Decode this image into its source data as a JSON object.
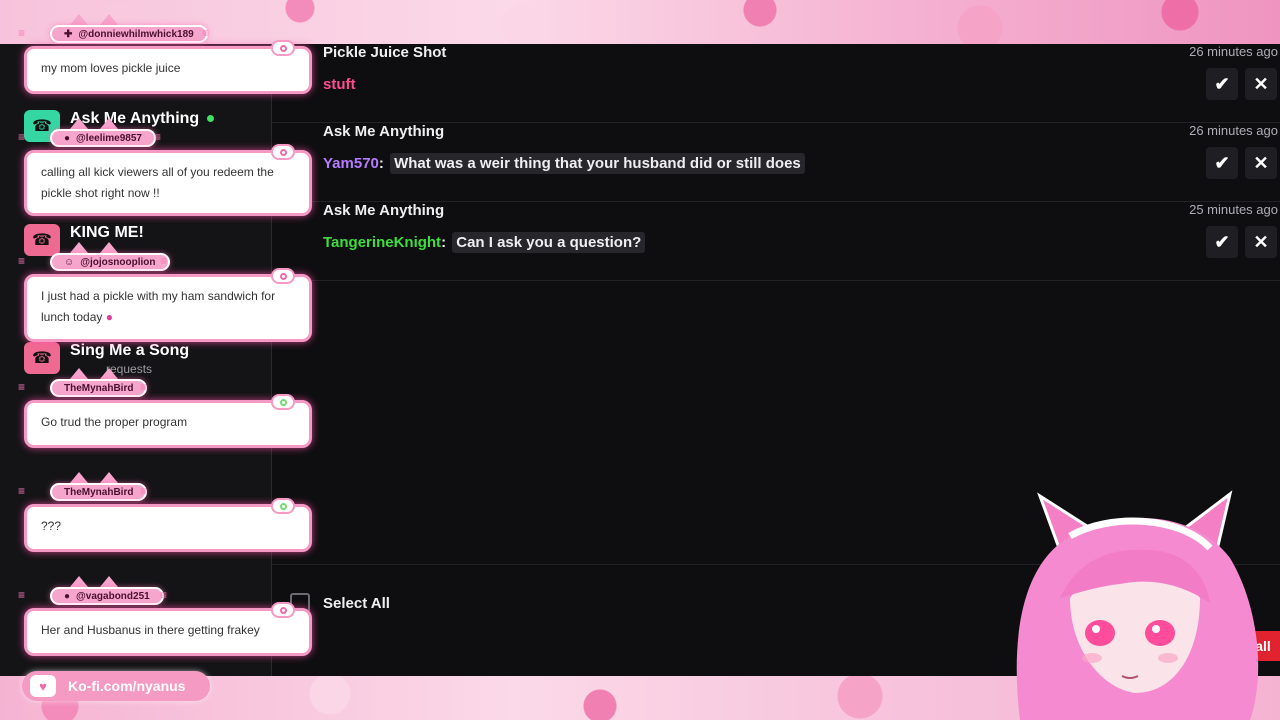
{
  "sidebar": {
    "items": [
      {
        "title": "Ask Me Anything",
        "icon": "phone-icon",
        "icon_color": "#34d7a2",
        "online": true,
        "subtitle": ""
      },
      {
        "title": "KING ME!",
        "icon": "phone-icon",
        "icon_color": "#ef6a92",
        "online": false,
        "subtitle": ""
      },
      {
        "title": "Sing Me a Song",
        "icon": "phone-icon",
        "icon_color": "#ef6a92",
        "online": false,
        "subtitle": "requests"
      }
    ]
  },
  "requests": [
    {
      "title": "Pickle Juice Shot",
      "time": "26 minutes ago",
      "user": "",
      "message": "stuft",
      "user_color": "#ff4d8d"
    },
    {
      "title": "Ask Me Anything",
      "time": "26 minutes ago",
      "user": "Yam570",
      "message": "What was a weir thing that your husband did or still does",
      "user_color": "#b67cff"
    },
    {
      "title": "Ask Me Anything",
      "time": "25 minutes ago",
      "user": "TangerineKnight",
      "message": "Can I ask you a question?",
      "user_color": "#3dde3d"
    }
  ],
  "actions": {
    "accept_icon": "✔",
    "reject_icon": "✕",
    "select_all": "Select All",
    "reject_all": "all"
  },
  "chat": [
    {
      "name": "@donniewhilmwhick189",
      "text": "my mom loves pickle juice"
    },
    {
      "name": "@leelime9857",
      "text": "calling all kick viewers all of you redeem the pickle shot right now !!"
    },
    {
      "name": "@jojosnooplion",
      "text": "I just had a pickle with my ham sandwich for lunch today"
    },
    {
      "name": "TheMynahBird",
      "text": "Go trud the proper program"
    },
    {
      "name": "TheMynahBird",
      "text": "???"
    },
    {
      "name": "@vagabond251",
      "text": "Her and Husbanus in there getting frakey"
    }
  ],
  "kofi": {
    "label": "Ko-fi.com/nyanus"
  },
  "colors": {
    "accent_pink": "#f59ac4",
    "panel_bg": "#0e0e10",
    "reject_red": "#e0232e"
  }
}
